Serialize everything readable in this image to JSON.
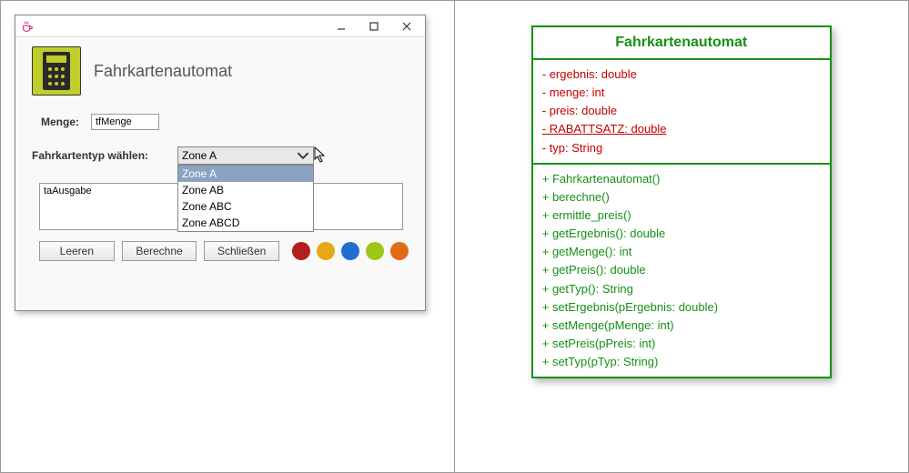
{
  "app": {
    "title": "Fahrkartenautomat",
    "menge_label": "Menge:",
    "menge_value": "tfMenge",
    "type_label": "Fahrkartentyp wählen:",
    "combo_selected": "Zone A",
    "combo_options": [
      "Zone A",
      "Zone AB",
      "Zone ABC",
      "Zone ABCD"
    ],
    "textarea_value": "taAusgabe",
    "buttons": {
      "clear": "Leeren",
      "calculate": "Berechne",
      "close": "Schließen"
    },
    "dot_colors": [
      "#b31f1f",
      "#e6a817",
      "#1f6fd0",
      "#9ec617",
      "#e36a14"
    ]
  },
  "uml": {
    "class_name": "Fahrkartenautomat",
    "attributes": [
      {
        "vis": "-",
        "text": "ergebnis: double",
        "static": false
      },
      {
        "vis": "-",
        "text": "menge: int",
        "static": false
      },
      {
        "vis": "-",
        "text": "preis: double",
        "static": false
      },
      {
        "vis": "-",
        "text": "RABATTSATZ: double",
        "static": true
      },
      {
        "vis": "-",
        "text": "typ: String",
        "static": false
      }
    ],
    "methods": [
      {
        "vis": "+",
        "text": "Fahrkartenautomat()"
      },
      {
        "vis": "+",
        "text": "berechne()"
      },
      {
        "vis": "+",
        "text": "ermittle_preis()"
      },
      {
        "vis": "+",
        "text": "getErgebnis(): double"
      },
      {
        "vis": "+",
        "text": "getMenge(): int"
      },
      {
        "vis": "+",
        "text": "getPreis(): double"
      },
      {
        "vis": "+",
        "text": "getTyp(): String"
      },
      {
        "vis": "+",
        "text": "setErgebnis(pErgebnis: double)"
      },
      {
        "vis": "+",
        "text": "setMenge(pMenge: int)"
      },
      {
        "vis": "+",
        "text": "setPreis(pPreis: int)"
      },
      {
        "vis": "+",
        "text": "setTyp(pTyp: String)"
      }
    ]
  }
}
